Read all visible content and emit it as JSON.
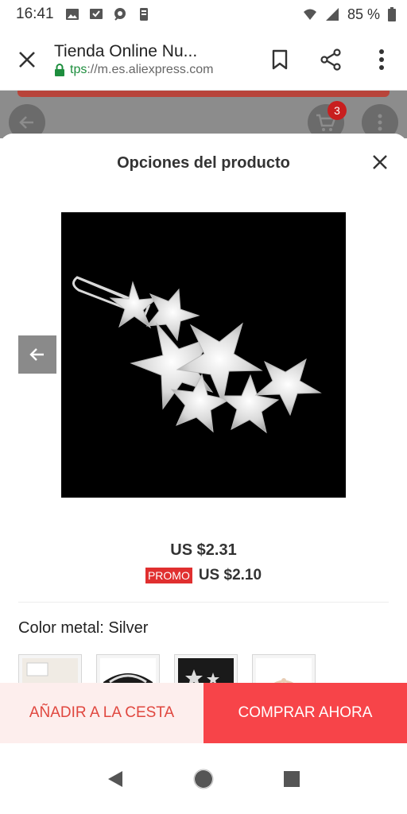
{
  "status_bar": {
    "time": "16:41",
    "battery": "85 %",
    "notification_icons": [
      "image-icon",
      "check-message-icon",
      "chat-icon",
      "phone-icon"
    ]
  },
  "browser": {
    "title": "Tienda Online Nu...",
    "url_scheme": "tps",
    "url_rest": "://m.es.aliexpress.com"
  },
  "page": {
    "cart_count": "3"
  },
  "sheet": {
    "title": "Opciones del producto",
    "price": "US $2.31",
    "promo_badge": "PROMO",
    "promo_price": "US $2.10",
    "color_label": "Color metal: Silver",
    "thumbnails": [
      "thumb-1",
      "thumb-2",
      "thumb-3",
      "thumb-4"
    ]
  },
  "actions": {
    "add_to_cart": "AÑADIR A LA CESTA",
    "buy_now": "COMPRAR AHORA"
  },
  "colors": {
    "accent": "#f74449",
    "cart_bg": "#fdeeed",
    "cart_text": "#e0473f",
    "promo": "#e02f2f",
    "secure_green": "#1e8e3e"
  }
}
